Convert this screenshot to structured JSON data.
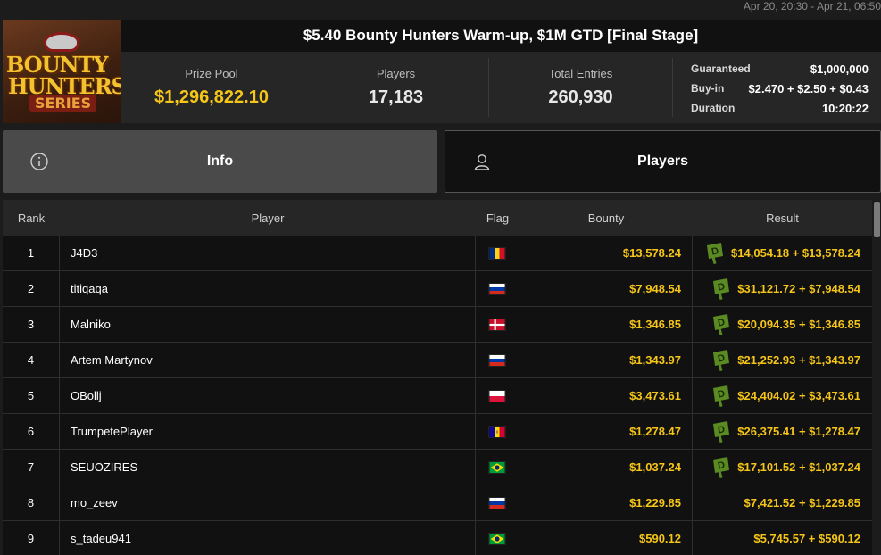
{
  "date_range": "Apr 20, 20:30 - Apr 21, 06:50",
  "logo": {
    "line1": "BOUNTY",
    "line2": "HUNTERS",
    "line3": "SERIES"
  },
  "title": "$5.40 Bounty Hunters Warm-up, $1M GTD [Final Stage]",
  "stats": {
    "prize_pool_label": "Prize Pool",
    "prize_pool_value": "$1,296,822.10",
    "players_label": "Players",
    "players_value": "17,183",
    "entries_label": "Total Entries",
    "entries_value": "260,930"
  },
  "details": {
    "guaranteed_label": "Guaranteed",
    "guaranteed_value": "$1,000,000",
    "buyin_label": "Buy-in",
    "buyin_value": "$2.470 + $2.50 + $0.43",
    "duration_label": "Duration",
    "duration_value": "10:20:22"
  },
  "tabs": {
    "info_label": "Info",
    "info_icon": "info-circle-icon",
    "players_label": "Players",
    "players_icon": "user-icon"
  },
  "columns": {
    "rank": "Rank",
    "player": "Player",
    "flag": "Flag",
    "bounty": "Bounty",
    "result": "Result"
  },
  "colors": {
    "accent_gold": "#f5c518",
    "ticket_green": "#4d7d1a"
  },
  "rows": [
    {
      "rank": "1",
      "player": "J4D3",
      "flag": "romania",
      "bounty": "$13,578.24",
      "result": "$14,054.18 + $13,578.24",
      "ticket": true
    },
    {
      "rank": "2",
      "player": "titiqaqa",
      "flag": "russia",
      "bounty": "$7,948.54",
      "result": "$31,121.72 + $7,948.54",
      "ticket": true
    },
    {
      "rank": "3",
      "player": "Malniko",
      "flag": "denmark",
      "bounty": "$1,346.85",
      "result": "$20,094.35 + $1,346.85",
      "ticket": true
    },
    {
      "rank": "4",
      "player": "Artem Martynov",
      "flag": "russia",
      "bounty": "$1,343.97",
      "result": "$21,252.93 + $1,343.97",
      "ticket": true
    },
    {
      "rank": "5",
      "player": "OBollj",
      "flag": "poland",
      "bounty": "$3,473.61",
      "result": "$24,404.02 + $3,473.61",
      "ticket": true
    },
    {
      "rank": "6",
      "player": "TrumpetePlayer",
      "flag": "andorra",
      "bounty": "$1,278.47",
      "result": "$26,375.41 + $1,278.47",
      "ticket": true
    },
    {
      "rank": "7",
      "player": "SEUOZIRES",
      "flag": "brazil",
      "bounty": "$1,037.24",
      "result": "$17,101.52 + $1,037.24",
      "ticket": true
    },
    {
      "rank": "8",
      "player": "mo_zeev",
      "flag": "russia",
      "bounty": "$1,229.85",
      "result": "$7,421.52 + $1,229.85",
      "ticket": false
    },
    {
      "rank": "9",
      "player": "s_tadeu941",
      "flag": "brazil",
      "bounty": "$590.12",
      "result": "$5,745.57 + $590.12",
      "ticket": false
    }
  ]
}
